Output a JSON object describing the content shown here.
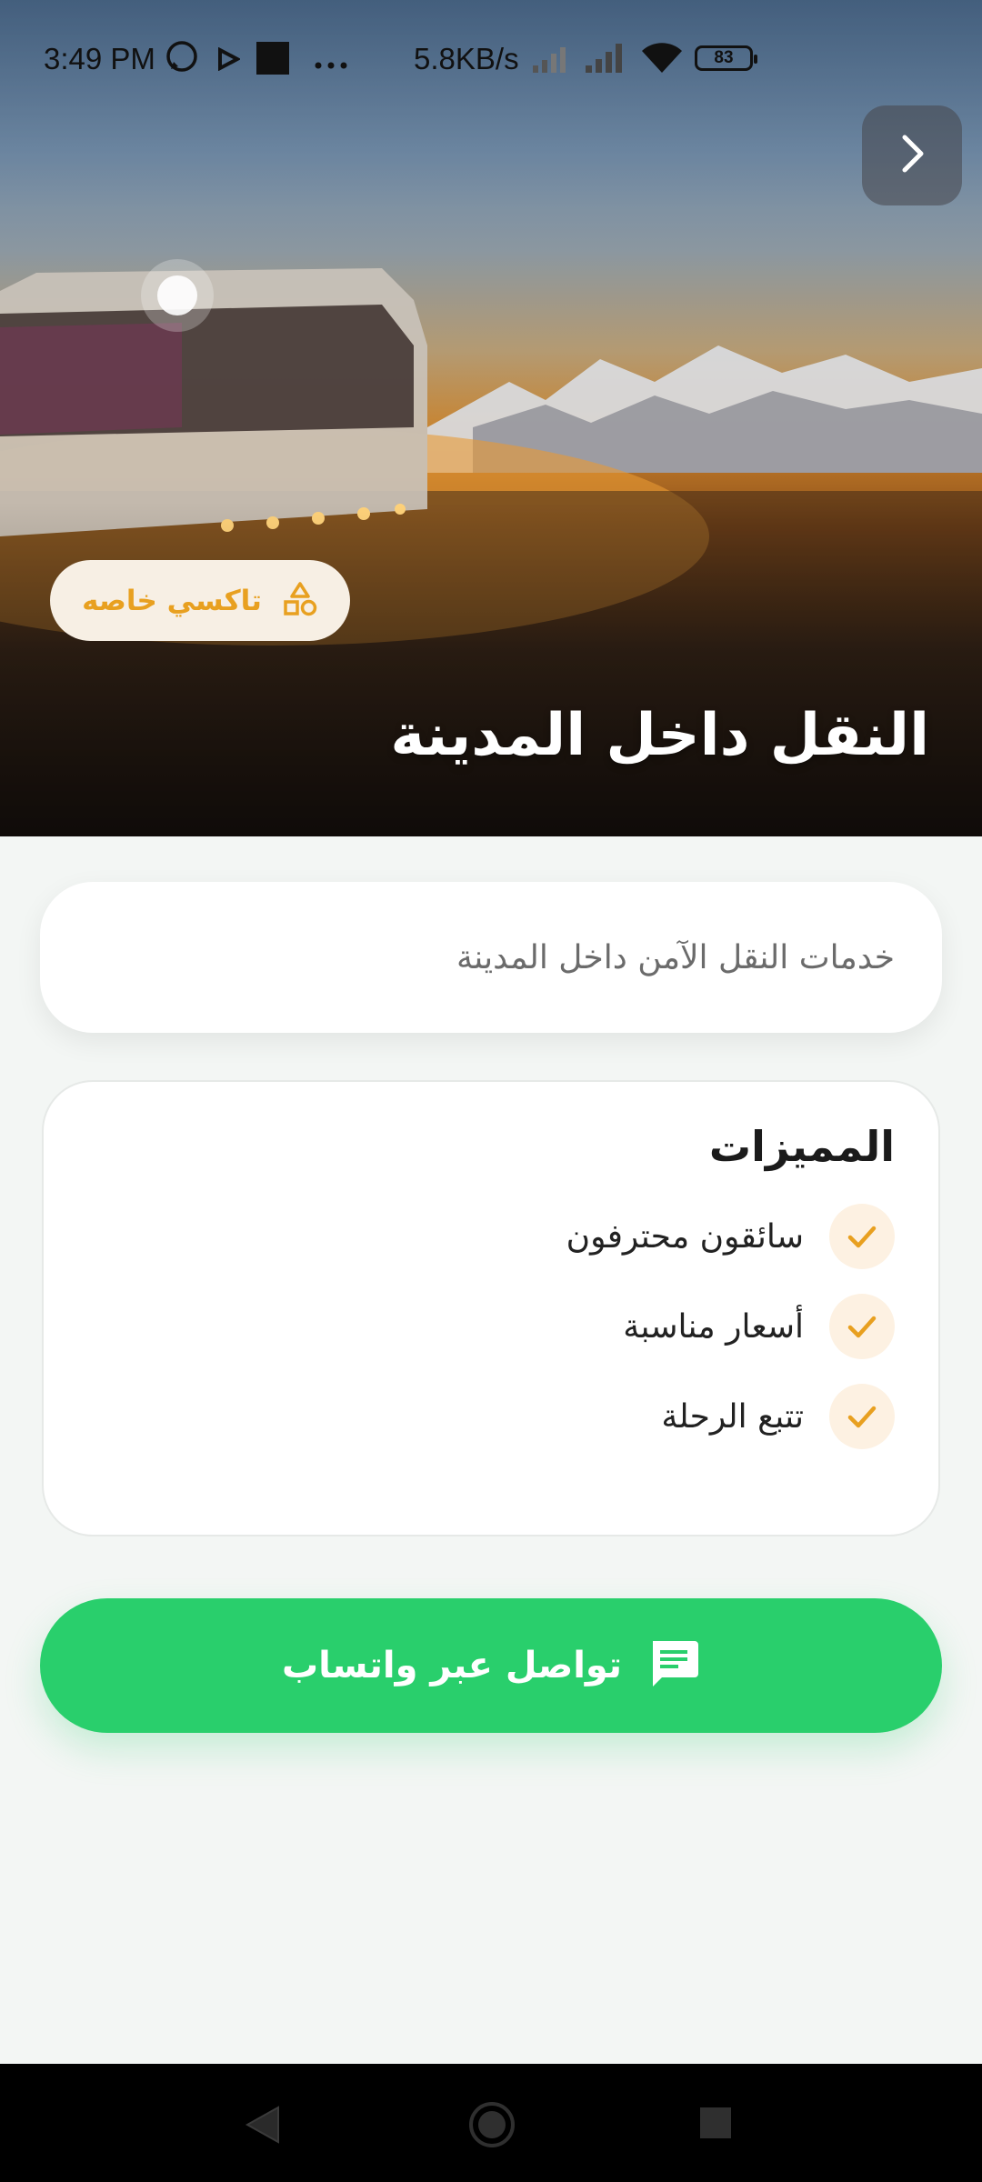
{
  "status_bar": {
    "time": "3:49 PM",
    "network_speed": "5.8KB/s",
    "battery": "83"
  },
  "hero": {
    "badge_label": "تاكسي خاصه",
    "title": "النقل داخل المدينة"
  },
  "description": "خدمات النقل الآمن داخل المدينة",
  "features": {
    "title": "المميزات",
    "items": [
      "سائقون محترفون",
      "أسعار مناسبة",
      "تتبع الرحلة"
    ]
  },
  "cta": {
    "label": "تواصل عبر واتساب"
  },
  "colors": {
    "accent": "#e8a020",
    "whatsapp_green": "#29cf6c",
    "page_background": "#f3f6f4"
  },
  "icons": {
    "back": "chevron-right-icon",
    "badge": "shapes-icon",
    "feature": "check-icon",
    "cta": "chat-icon"
  }
}
